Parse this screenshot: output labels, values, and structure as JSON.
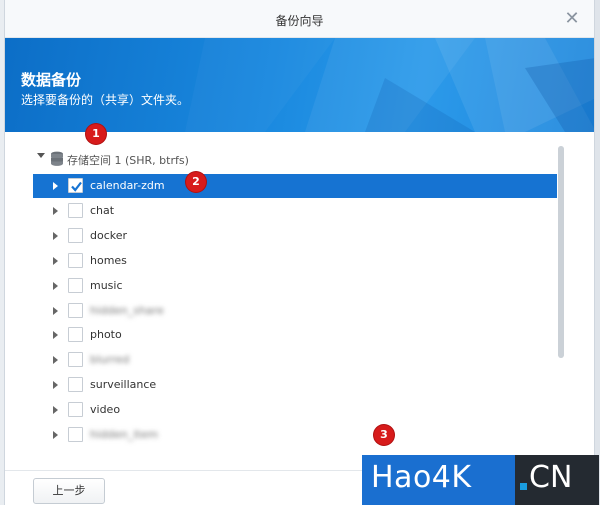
{
  "window": {
    "title": "备份向导"
  },
  "banner": {
    "heading": "数据备份",
    "subtitle": "选择要备份的（共享）文件夹。"
  },
  "tree": {
    "root_label": "存储空间 1 (SHR, btrfs)",
    "items": [
      {
        "name": "calendar-zdm",
        "checked": true,
        "selected": true,
        "blurred": false
      },
      {
        "name": "chat",
        "checked": false,
        "selected": false,
        "blurred": false
      },
      {
        "name": "docker",
        "checked": false,
        "selected": false,
        "blurred": false
      },
      {
        "name": "homes",
        "checked": false,
        "selected": false,
        "blurred": false
      },
      {
        "name": "music",
        "checked": false,
        "selected": false,
        "blurred": false
      },
      {
        "name": "hidden_share",
        "checked": false,
        "selected": false,
        "blurred": true
      },
      {
        "name": "photo",
        "checked": false,
        "selected": false,
        "blurred": false
      },
      {
        "name": "blurred",
        "checked": false,
        "selected": false,
        "blurred": true
      },
      {
        "name": "surveillance",
        "checked": false,
        "selected": false,
        "blurred": false
      },
      {
        "name": "video",
        "checked": false,
        "selected": false,
        "blurred": false
      },
      {
        "name": "hidden_item",
        "checked": false,
        "selected": false,
        "blurred": true
      }
    ]
  },
  "footer": {
    "prev_label": "上一步"
  },
  "annotations": [
    "1",
    "2",
    "3"
  ],
  "watermark": {
    "left_text": "Hao4K",
    "right_text": "CN"
  },
  "colors": {
    "accent": "#1673d2",
    "banner": "#1a89df",
    "badge": "#d71b1b"
  }
}
